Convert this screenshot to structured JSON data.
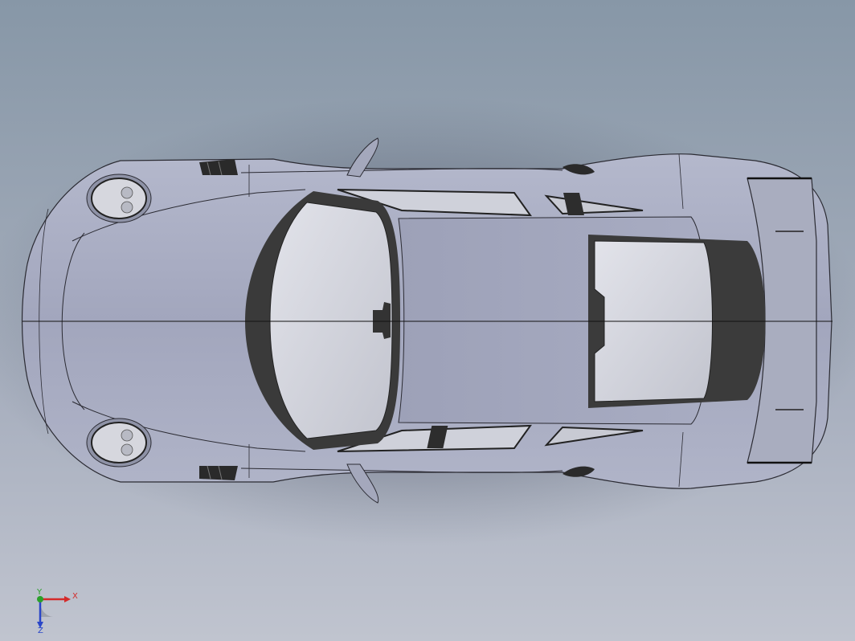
{
  "viewport": {
    "view_orientation": "top"
  },
  "model": {
    "colors": {
      "body": "#a6aac0",
      "body_dark": "#7c8096",
      "glass": "#d2d4dc",
      "trim": "#3d3d3d",
      "background_top": "#8797a7",
      "background_bottom": "#c0c4cf"
    }
  },
  "triad": {
    "x_label": "X",
    "y_label": "Y",
    "z_label": "Z",
    "x_color": "#d42a2a",
    "y_color": "#2aa02a",
    "z_color": "#2a46c8"
  }
}
